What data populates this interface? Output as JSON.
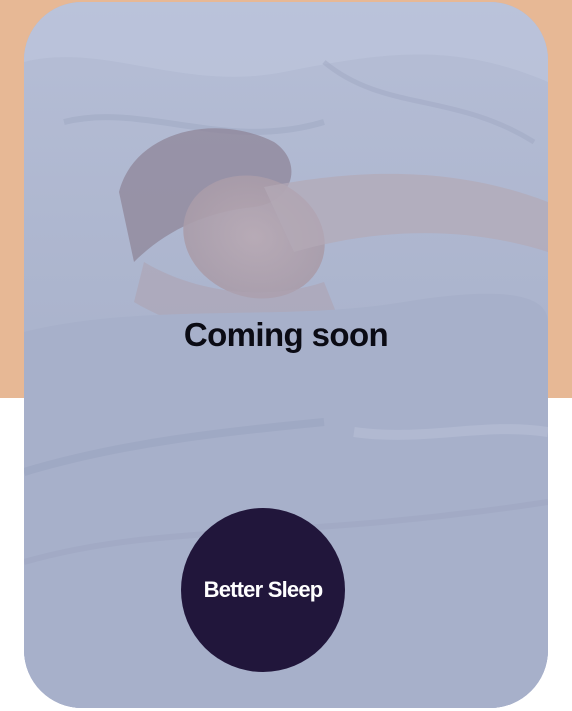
{
  "colors": {
    "band_background": "#e7b895",
    "page_background": "#ffffff",
    "card_overlay": "#a9b2cc",
    "badge_background": "#21163b",
    "badge_text": "#ffffff",
    "title_text": "#0b0b14"
  },
  "card": {
    "image": "person-sleeping-photo",
    "title": "Coming soon",
    "badge_label": "Better Sleep"
  }
}
